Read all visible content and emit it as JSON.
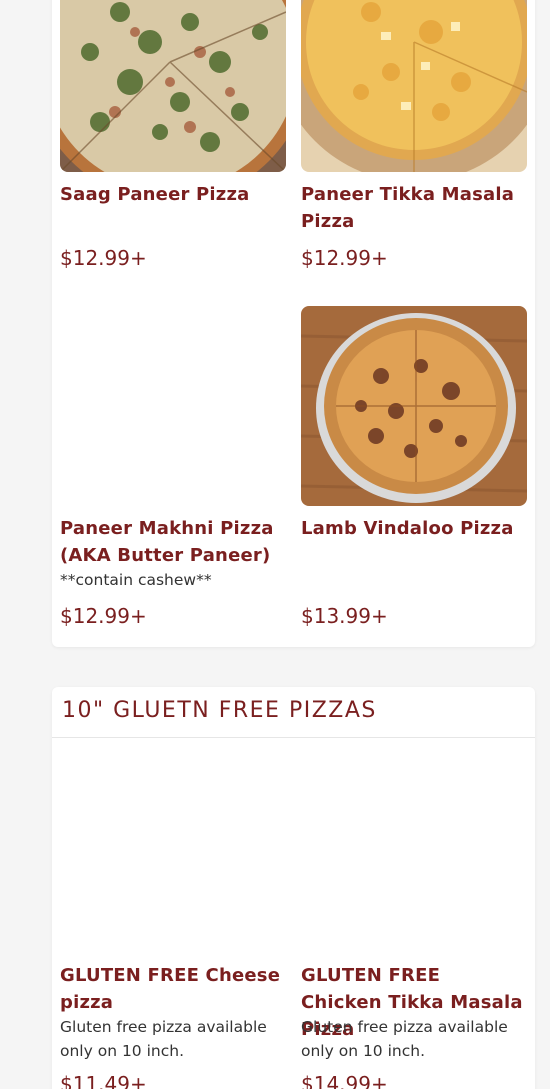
{
  "colors": {
    "accent": "#7a1f1f",
    "page_bg": "#f5f5f5",
    "card_bg": "#ffffff",
    "text": "#333333"
  },
  "menu_top": {
    "items": [
      {
        "name": "Saag Paneer Pizza",
        "desc": "",
        "price": "$12.99+",
        "image": "saag-paneer-pizza-photo"
      },
      {
        "name": "Paneer Tikka Masala Pizza",
        "desc": "",
        "price": "$12.99+",
        "image": "paneer-tikka-masala-pizza-photo"
      },
      {
        "name": "Paneer Makhni Pizza (AKA Butter Paneer)",
        "desc": "**contain cashew**",
        "price": "$12.99+",
        "image": ""
      },
      {
        "name": "Lamb Vindaloo Pizza",
        "desc": "",
        "price": "$13.99+",
        "image": "lamb-vindaloo-pizza-photo"
      }
    ]
  },
  "gluten_free": {
    "title": "10\" GLUETN FREE PIZZAS",
    "items": [
      {
        "name": "GLUTEN FREE Cheese pizza",
        "desc": "Gluten free pizza available only on 10 inch.",
        "price": "$11.49+"
      },
      {
        "name": "GLUTEN FREE Chicken Tikka Masala Pizza",
        "desc": "Gluten free pizza available only on 10 inch.",
        "price": "$14.99+"
      }
    ]
  }
}
